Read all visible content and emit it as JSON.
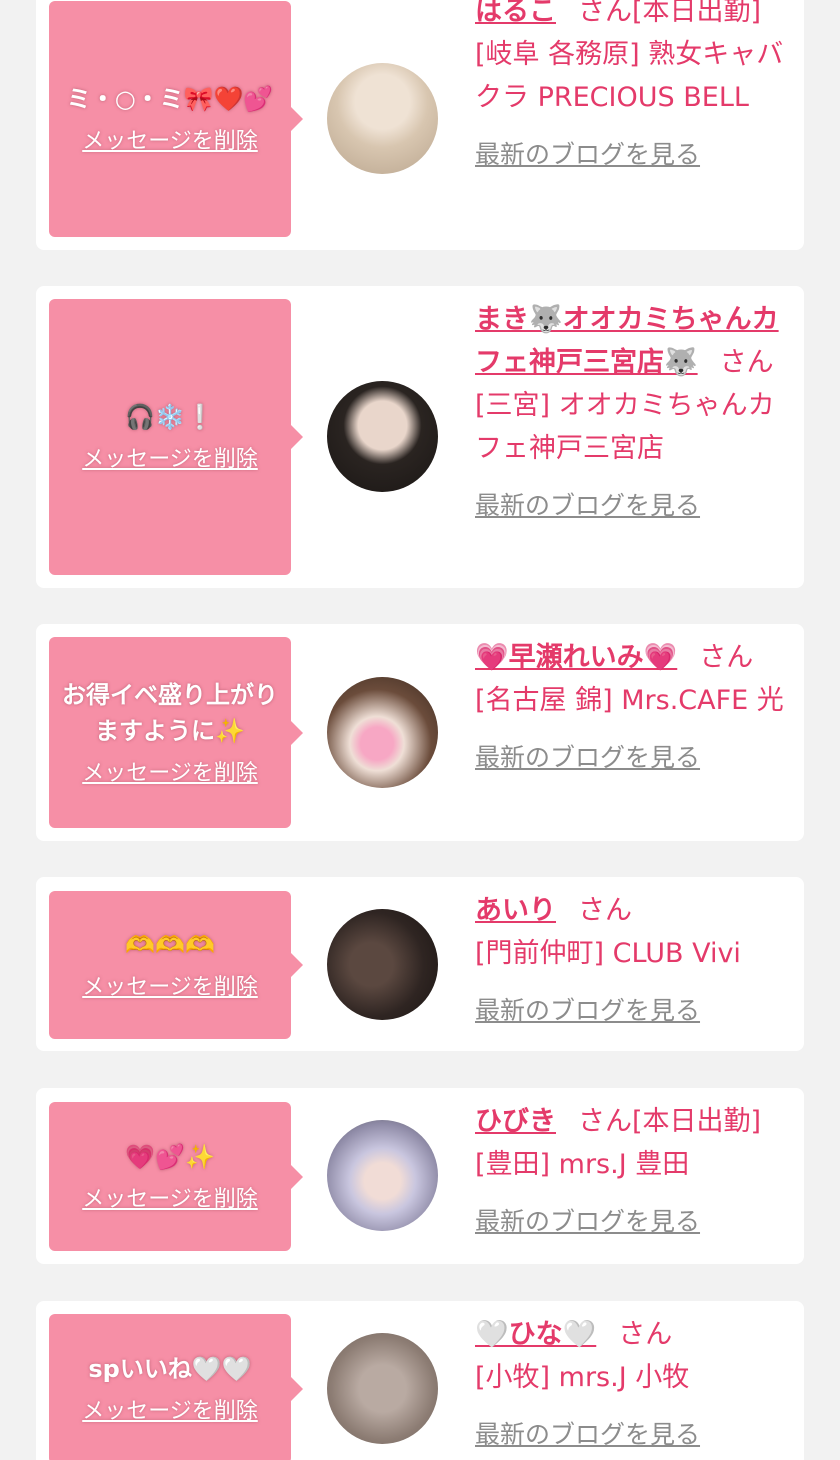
{
  "entries": [
    {
      "message": "ミ・○・ミ🎀❤️💕",
      "delete_label": "メッセージを削除",
      "name": "はるこ",
      "honorific": "さん",
      "status": "[本日出勤]",
      "shop": "[岐阜 各務原] 熟女キャバクラ PRECIOUS BELL",
      "blog_label": "最新のブログを見る"
    },
    {
      "message": "🎧❄️❕",
      "delete_label": "メッセージを削除",
      "name": "まき🐺オオカミちゃんカフェ神戸三宮店🐺",
      "honorific": "さん",
      "status": "",
      "shop": "[三宮] オオカミちゃんカフェ神戸三宮店",
      "blog_label": "最新のブログを見る"
    },
    {
      "message": "お得イベ盛り上がりますように✨",
      "delete_label": "メッセージを削除",
      "name": "💗早瀬れいみ💗",
      "honorific": "さん",
      "status": "",
      "shop": "[名古屋 錦] Mrs.CAFE 光",
      "blog_label": "最新のブログを見る"
    },
    {
      "message": "🫶🫶🫶",
      "delete_label": "メッセージを削除",
      "name": "あいり",
      "honorific": "さん",
      "status": "",
      "shop": "[門前仲町] CLUB Vivi",
      "blog_label": "最新のブログを見る"
    },
    {
      "message": "💗💕✨",
      "delete_label": "メッセージを削除",
      "name": "ひびき",
      "honorific": "さん",
      "status": "[本日出勤]",
      "shop": "[豊田] mrs.J 豊田",
      "blog_label": "最新のブログを見る"
    },
    {
      "message": "spいいね🤍🤍",
      "delete_label": "メッセージを削除",
      "name": "🤍ひな🤍",
      "honorific": "さん",
      "status": "",
      "shop": "[小牧] mrs.J 小牧",
      "blog_label": "最新のブログを見る"
    }
  ],
  "colors": {
    "page_bg": "#f2f2f2",
    "bubble_pink": "#f68fa6",
    "accent": "#e43a6a",
    "link_gray": "#8c8c8c"
  }
}
